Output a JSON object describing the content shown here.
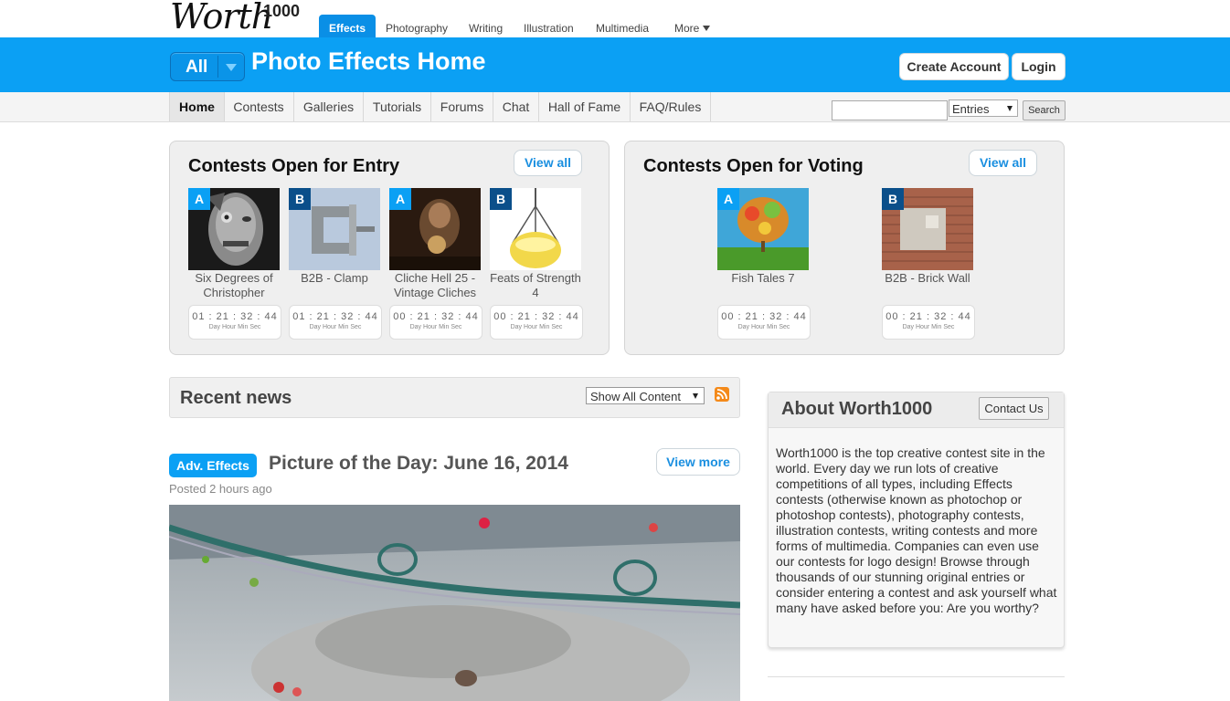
{
  "logo": {
    "word": "Worth",
    "number": "1000"
  },
  "category_tabs": [
    "Effects",
    "Photography",
    "Writing",
    "Illustration",
    "Multimedia",
    "More"
  ],
  "header": {
    "scope_label": "All",
    "title": "Photo Effects Home",
    "create_account": "Create Account",
    "login": "Login"
  },
  "subnav": [
    "Home",
    "Contests",
    "Galleries",
    "Tutorials",
    "Forums",
    "Chat",
    "Hall of Fame",
    "FAQ/Rules"
  ],
  "search": {
    "value": "",
    "type_selected": "Entries",
    "button": "Search"
  },
  "entry_panel": {
    "title": "Contests Open for Entry",
    "view_all": "View all",
    "contests": [
      {
        "badge": "A",
        "title": "Six Degrees of Christopher",
        "time": "01 : 21 : 32 : 44",
        "units": "Day Hour Min Sec"
      },
      {
        "badge": "B",
        "title": "B2B - Clamp",
        "time": "01 : 21 : 32 : 44",
        "units": "Day Hour Min Sec"
      },
      {
        "badge": "A",
        "title": "Cliche Hell 25 - Vintage Cliches",
        "time": "00 : 21 : 32 : 44",
        "units": "Day Hour Min Sec"
      },
      {
        "badge": "B",
        "title": "Feats of Strength 4",
        "time": "00 : 21 : 32 : 44",
        "units": "Day Hour Min Sec"
      }
    ]
  },
  "voting_panel": {
    "title": "Contests Open for Voting",
    "view_all": "View all",
    "contests": [
      {
        "badge": "A",
        "title": "Fish Tales 7",
        "time": "00 : 21 : 32 : 44",
        "units": "Day Hour Min Sec"
      },
      {
        "badge": "B",
        "title": "B2B - Brick Wall",
        "time": "00 : 21 : 32 : 44",
        "units": "Day Hour Min Sec"
      }
    ]
  },
  "news": {
    "title": "Recent news",
    "filter_selected": "Show All Content",
    "post": {
      "tag": "Adv. Effects",
      "title": "Picture of the Day: June 16, 2014",
      "posted": "Posted 2 hours ago",
      "view_more": "View more"
    }
  },
  "about": {
    "title": "About Worth1000",
    "contact": "Contact Us",
    "text": "Worth1000 is the top creative contest site in the world. Every day we run lots of creative competitions of all types, including Effects contests (otherwise known as photochop or photoshop contests), photography contests, illustration contests, writing contests and more forms of multimedia. Companies can even use our contests for logo design! Browse through thousands of our stunning original entries or consider entering a contest and ask yourself what many have asked before you: Are you worthy?"
  },
  "colors": {
    "accent": "#0ba0f4",
    "badge_dark": "#0b4f8a",
    "link": "#1a8fe0"
  }
}
